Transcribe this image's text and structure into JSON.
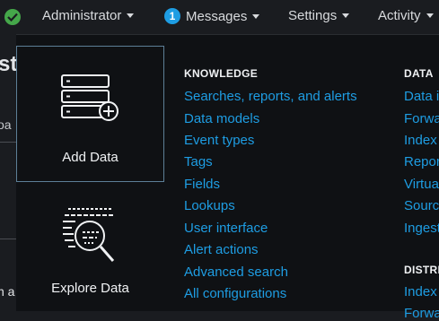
{
  "colors": {
    "accent_link": "#1e9de3",
    "status_ok": "#45a74a",
    "badge_bg": "#1e9de3",
    "panel_bg": "#0f1114",
    "topbar_bg": "#1a1c20"
  },
  "topbar": {
    "status_icon": "check-circle-icon",
    "user": "Administrator",
    "messages_count": "1",
    "messages": "Messages",
    "settings": "Settings",
    "activity": "Activity"
  },
  "background_page": {
    "title_fragment": "st",
    "tab_fragment": "oa",
    "text_fragment": "n a"
  },
  "tiles": [
    {
      "label": "Add Data",
      "icon": "add-data-icon",
      "selected": true
    },
    {
      "label": "Explore Data",
      "icon": "explore-data-icon",
      "selected": false
    }
  ],
  "knowledge": {
    "title": "KNOWLEDGE",
    "links": [
      "Searches, reports, and alerts",
      "Data models",
      "Event types",
      "Tags",
      "Fields",
      "Lookups",
      "User interface",
      "Alert actions",
      "Advanced search",
      "All configurations"
    ]
  },
  "data": {
    "title": "DATA",
    "links": [
      "Data i",
      "Forwa",
      "Index",
      "Repor",
      "Virtua",
      "Sourc",
      "Ingest"
    ]
  },
  "distributed": {
    "title": "DISTRI",
    "links": [
      "Index",
      "Forwa"
    ]
  }
}
